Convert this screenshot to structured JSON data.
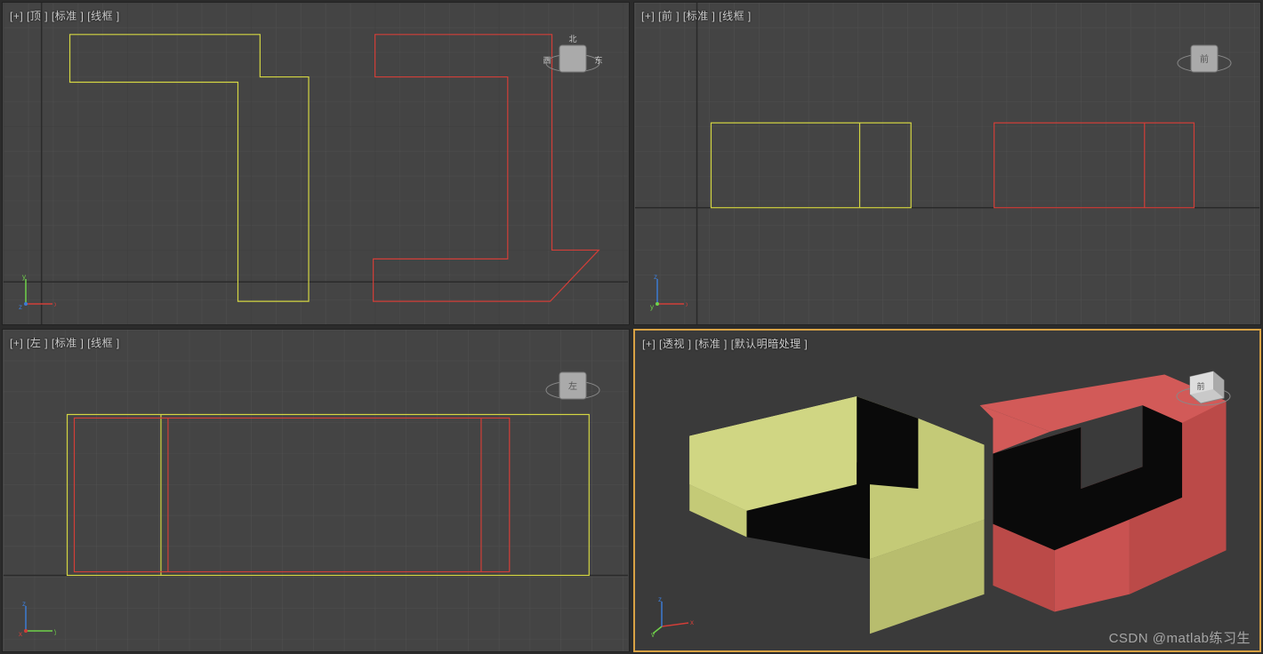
{
  "viewports": {
    "top": {
      "plus": "[+]",
      "name": "[顶 ]",
      "mode": "[标准 ]",
      "shade": "[线框 ]",
      "cube_face": "北",
      "cube_w": "西",
      "cube_e": "东"
    },
    "front": {
      "plus": "[+]",
      "name": "[前 ]",
      "mode": "[标准 ]",
      "shade": "[线框 ]",
      "cube_face": "前"
    },
    "left": {
      "plus": "[+]",
      "name": "[左 ]",
      "mode": "[标准 ]",
      "shade": "[线框 ]",
      "cube_face": "左"
    },
    "persp": {
      "plus": "[+]",
      "name": "[透视 ]",
      "mode": "[标准 ]",
      "shade": "[默认明暗处理 ]",
      "cube_face": "前"
    }
  },
  "colors": {
    "obj_yellow": "#d4d642",
    "obj_red": "#d23e38",
    "grid_minor": "#575757",
    "grid_major": "#333",
    "axis_x": "#d23e38",
    "axis_y": "#6fd24a",
    "axis_z": "#3d7bd2",
    "persp_yellow_top": "#d0d683",
    "persp_yellow_side": "#b8bd6e",
    "persp_red_top": "#d25a58",
    "persp_red_side": "#bb4a48",
    "persp_dark": "#0a0a0a"
  },
  "watermark": "CSDN @matlab练习生"
}
